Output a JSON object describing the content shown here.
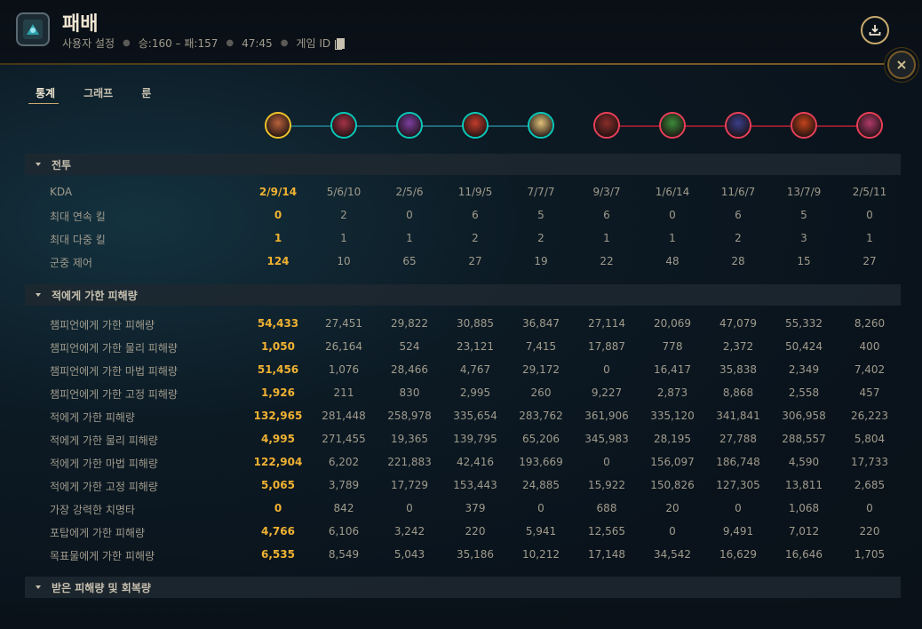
{
  "header": {
    "title": "패배",
    "settings_label": "사용자 설정",
    "record": "승:160 – 패:157",
    "duration": "47:45",
    "game_id_label": "게임 ID"
  },
  "tabs": [
    "통계",
    "그래프",
    "룬"
  ],
  "champions": {
    "blue": [
      "#b8623a",
      "#a33245",
      "#7c3fa0",
      "#c23c2c",
      "#e0c27a"
    ],
    "red": [
      "#8a2d2a",
      "#3c8a3a",
      "#3a3f8a",
      "#c2421a",
      "#b03a6a"
    ]
  },
  "colors": {
    "accent_gold": "#c8aa6e",
    "highlight": "#f0b232",
    "blue_team": "#0ac8b9",
    "red_team": "#e84057"
  },
  "sections": [
    {
      "title": "전투",
      "rows": [
        {
          "label": "KDA",
          "values": [
            "2/9/14",
            "5/6/10",
            "2/5/6",
            "11/9/5",
            "7/7/7",
            "9/3/7",
            "1/6/14",
            "11/6/7",
            "13/7/9",
            "2/5/11"
          ]
        },
        {
          "label": "최대 연속 킬",
          "values": [
            "0",
            "2",
            "0",
            "6",
            "5",
            "6",
            "0",
            "6",
            "5",
            "0"
          ]
        },
        {
          "label": "최대 다중 킬",
          "values": [
            "1",
            "1",
            "1",
            "2",
            "2",
            "1",
            "1",
            "2",
            "3",
            "1"
          ]
        },
        {
          "label": "군중 제어",
          "values": [
            "124",
            "10",
            "65",
            "27",
            "19",
            "22",
            "48",
            "28",
            "15",
            "27"
          ]
        }
      ]
    },
    {
      "title": "적에게 가한 피해량",
      "rows": [
        {
          "label": "챔피언에게 가한 피해량",
          "values": [
            "54,433",
            "27,451",
            "29,822",
            "30,885",
            "36,847",
            "27,114",
            "20,069",
            "47,079",
            "55,332",
            "8,260"
          ]
        },
        {
          "label": "챔피언에게 가한 물리 피해량",
          "values": [
            "1,050",
            "26,164",
            "524",
            "23,121",
            "7,415",
            "17,887",
            "778",
            "2,372",
            "50,424",
            "400"
          ]
        },
        {
          "label": "챔피언에게 가한 마법 피해량",
          "values": [
            "51,456",
            "1,076",
            "28,466",
            "4,767",
            "29,172",
            "0",
            "16,417",
            "35,838",
            "2,349",
            "7,402"
          ]
        },
        {
          "label": "챔피언에게 가한 고정 피해량",
          "values": [
            "1,926",
            "211",
            "830",
            "2,995",
            "260",
            "9,227",
            "2,873",
            "8,868",
            "2,558",
            "457"
          ]
        },
        {
          "label": "적에게 가한 피해량",
          "values": [
            "132,965",
            "281,448",
            "258,978",
            "335,654",
            "283,762",
            "361,906",
            "335,120",
            "341,841",
            "306,958",
            "26,223"
          ]
        },
        {
          "label": "적에게 가한 물리 피해량",
          "values": [
            "4,995",
            "271,455",
            "19,365",
            "139,795",
            "65,206",
            "345,983",
            "28,195",
            "27,788",
            "288,557",
            "5,804"
          ]
        },
        {
          "label": "적에게 가한 마법 피해량",
          "values": [
            "122,904",
            "6,202",
            "221,883",
            "42,416",
            "193,669",
            "0",
            "156,097",
            "186,748",
            "4,590",
            "17,733"
          ]
        },
        {
          "label": "적에게 가한 고정 피해량",
          "values": [
            "5,065",
            "3,789",
            "17,729",
            "153,443",
            "24,885",
            "15,922",
            "150,826",
            "127,305",
            "13,811",
            "2,685"
          ]
        },
        {
          "label": "가장 강력한 치명타",
          "values": [
            "0",
            "842",
            "0",
            "379",
            "0",
            "688",
            "20",
            "0",
            "1,068",
            "0"
          ]
        },
        {
          "label": "포탑에게 가한 피해량",
          "values": [
            "4,766",
            "6,106",
            "3,242",
            "220",
            "5,941",
            "12,565",
            "0",
            "9,491",
            "7,012",
            "220"
          ]
        },
        {
          "label": "목표물에게 가한 피해량",
          "values": [
            "6,535",
            "8,549",
            "5,043",
            "35,186",
            "10,212",
            "17,148",
            "34,542",
            "16,629",
            "16,646",
            "1,705"
          ]
        }
      ]
    },
    {
      "title": "받은 피해량 및 회복량",
      "rows": []
    }
  ]
}
